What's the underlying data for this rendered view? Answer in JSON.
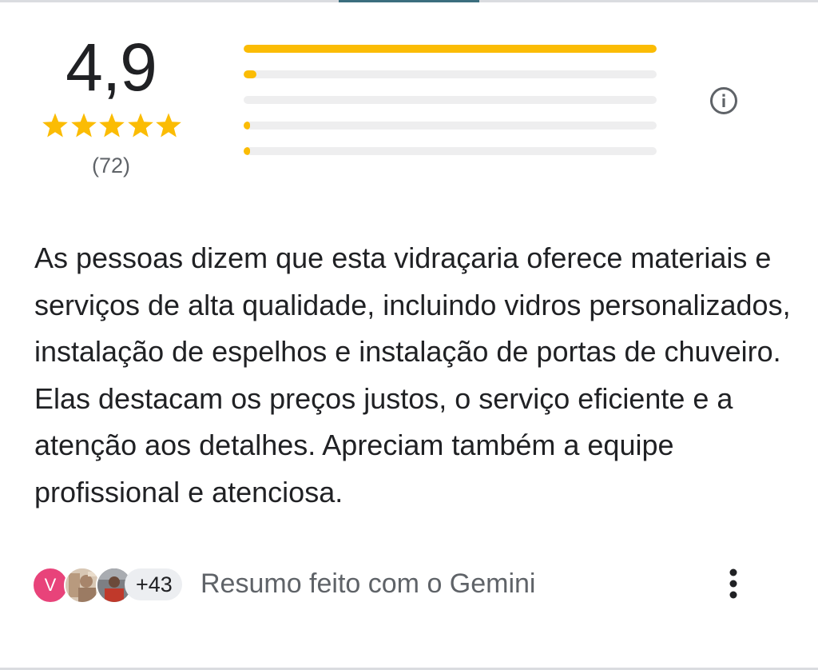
{
  "rating": {
    "score": "4,9",
    "stars_filled": 5,
    "stars_total": 5,
    "review_count": "(72)",
    "star_color": "#fbbc04"
  },
  "histogram": {
    "fill_color": "#fbbc04",
    "track_color": "#eeeeef",
    "rows": [
      {
        "stars": 5,
        "fraction": 1.0
      },
      {
        "stars": 4,
        "fraction": 0.03
      },
      {
        "stars": 3,
        "fraction": 0.0
      },
      {
        "stars": 2,
        "fraction": 0.015
      },
      {
        "stars": 1,
        "fraction": 0.015
      }
    ]
  },
  "info_icon": "info-icon",
  "summary_text": "As pessoas dizem que esta vidraçaria oferece materiais e serviços de alta qualidade, incluindo vidros personalizados, instalação de espelhos e instalação de portas de chuveiro. Elas destacam os preços justos, o serviço eficiente e a atenção aos detalhes. Apreciam também a equipe profissional e atenciosa.",
  "footer": {
    "avatar_initial": "V",
    "avatar_color": "#e8437a",
    "more_count": "+43",
    "label": "Resumo feito com o Gemini",
    "menu_icon": "more-vert-icon"
  }
}
